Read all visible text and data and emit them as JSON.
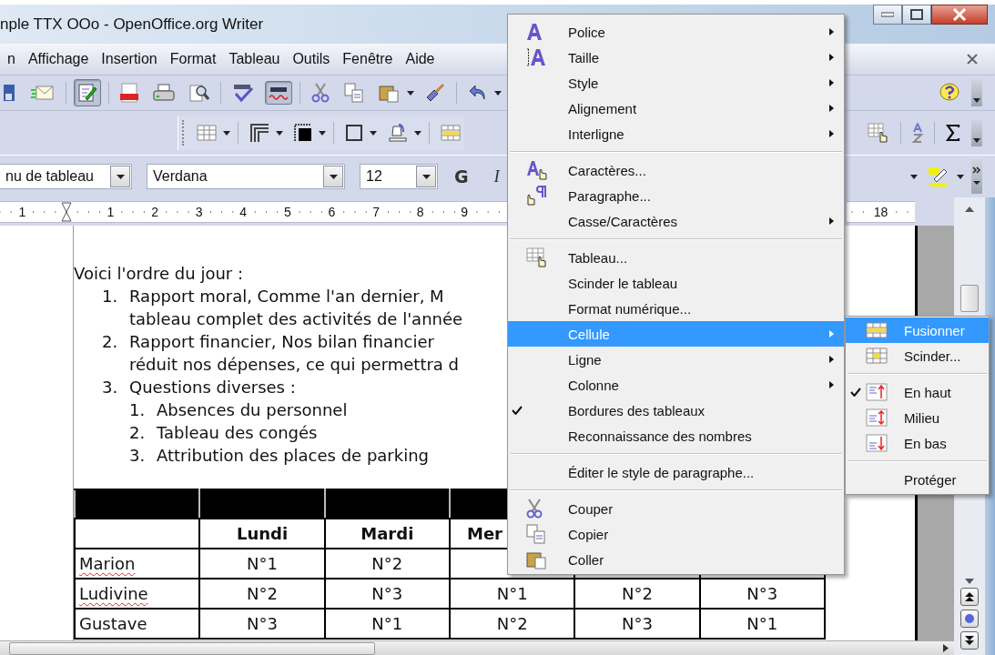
{
  "window": {
    "title": "nple TTX OOo - OpenOffice.org Writer"
  },
  "menu_bar": {
    "items": [
      {
        "label": "n"
      },
      {
        "label": "Affichage"
      },
      {
        "label": "Insertion"
      },
      {
        "label": "Format"
      },
      {
        "label": "Tableau"
      },
      {
        "label": "Outils"
      },
      {
        "label": "Fenêtre"
      },
      {
        "label": "Aide"
      }
    ]
  },
  "standard_toolbar": {
    "edit_mode_pressed": true,
    "autospell_pressed": true
  },
  "format_bar": {
    "paragraph_style": "nu de tableau",
    "font": "Verdana",
    "size": "12",
    "bold": "G",
    "italic": "I"
  },
  "ruler": {
    "labels": [
      "1",
      "1",
      "2",
      "3",
      "4",
      "5",
      "6",
      "7",
      "8",
      "9"
    ],
    "right_labels": [
      "18"
    ]
  },
  "document": {
    "intro": "Voici l'ordre du jour :",
    "list": [
      {
        "number": "1.",
        "lines": [
          "Rapport moral, Comme l'an dernier, M",
          "tableau complet des activités de l'année"
        ]
      },
      {
        "number": "2.",
        "lines": [
          "Rapport financier, Nos bilan financier",
          "réduit nos dépenses, ce qui permettra d"
        ]
      },
      {
        "number": "3.",
        "lines": [
          "Questions diverses :"
        ],
        "children": [
          {
            "number": "1.",
            "lines": [
              "Absences du personnel"
            ]
          },
          {
            "number": "2.",
            "lines": [
              "Tableau des congés"
            ]
          },
          {
            "number": "3.",
            "lines": [
              "Attribution des places de parking"
            ]
          }
        ]
      }
    ]
  },
  "table": {
    "columns": [
      {
        "label": "Lundi"
      },
      {
        "label": "Mardi"
      },
      {
        "label": "Mer"
      }
    ],
    "rows": [
      {
        "name": "Marion",
        "flagged": true,
        "cells": [
          "N°1",
          "N°2"
        ]
      },
      {
        "name": "Ludivine",
        "flagged": true,
        "cells": [
          "N°2",
          "N°3",
          "N°1",
          "N°2",
          "N°3"
        ]
      },
      {
        "name": "Gustave",
        "flagged": false,
        "cells": [
          "N°3",
          "N°1",
          "N°2",
          "N°3",
          "N°1"
        ]
      }
    ]
  },
  "context_menu": {
    "items": [
      {
        "kind": "item",
        "label": "Police",
        "submenu": true,
        "checked": false,
        "selected": false
      },
      {
        "kind": "item",
        "label": "Taille",
        "submenu": true,
        "checked": false,
        "selected": false
      },
      {
        "kind": "item",
        "label": "Style",
        "submenu": true,
        "checked": false,
        "selected": false
      },
      {
        "kind": "item",
        "label": "Alignement",
        "submenu": true,
        "checked": false,
        "selected": false
      },
      {
        "kind": "item",
        "label": "Interligne",
        "submenu": true,
        "checked": false,
        "selected": false
      },
      {
        "kind": "separator"
      },
      {
        "kind": "item",
        "label": "Caractères...",
        "submenu": false,
        "checked": false,
        "selected": false
      },
      {
        "kind": "item",
        "label": "Paragraphe...",
        "submenu": false,
        "checked": false,
        "selected": false
      },
      {
        "kind": "item",
        "label": "Casse/Caractères",
        "submenu": true,
        "checked": false,
        "selected": false
      },
      {
        "kind": "separator"
      },
      {
        "kind": "item",
        "label": "Tableau...",
        "submenu": false,
        "checked": false,
        "selected": false
      },
      {
        "kind": "item",
        "label": "Scinder le tableau",
        "submenu": false,
        "checked": false,
        "selected": false
      },
      {
        "kind": "item",
        "label": "Format numérique...",
        "submenu": false,
        "checked": false,
        "selected": false
      },
      {
        "kind": "item",
        "label": "Cellule",
        "submenu": true,
        "checked": false,
        "selected": true
      },
      {
        "kind": "item",
        "label": "Ligne",
        "submenu": true,
        "checked": false,
        "selected": false
      },
      {
        "kind": "item",
        "label": "Colonne",
        "submenu": true,
        "checked": false,
        "selected": false
      },
      {
        "kind": "item",
        "label": "Bordures des tableaux",
        "submenu": false,
        "checked": true,
        "selected": false
      },
      {
        "kind": "item",
        "label": "Reconnaissance des nombres",
        "submenu": false,
        "checked": false,
        "selected": false
      },
      {
        "kind": "separator"
      },
      {
        "kind": "item",
        "label": "Éditer le style de paragraphe...",
        "submenu": false,
        "checked": false,
        "selected": false
      },
      {
        "kind": "separator"
      },
      {
        "kind": "item",
        "label": "Couper",
        "submenu": false,
        "checked": false,
        "selected": false
      },
      {
        "kind": "item",
        "label": "Copier",
        "submenu": false,
        "checked": false,
        "selected": false
      },
      {
        "kind": "item",
        "label": "Coller",
        "submenu": false,
        "checked": false,
        "selected": false
      }
    ]
  },
  "cell_submenu": {
    "items": [
      {
        "kind": "item",
        "label": "Fusionner",
        "checked": false,
        "selected": true
      },
      {
        "kind": "item",
        "label": "Scinder...",
        "checked": false,
        "selected": false
      },
      {
        "kind": "separator"
      },
      {
        "kind": "item",
        "label": "En haut",
        "checked": true,
        "selected": false
      },
      {
        "kind": "item",
        "label": "Milieu",
        "checked": false,
        "selected": false
      },
      {
        "kind": "item",
        "label": "En bas",
        "checked": false,
        "selected": false
      },
      {
        "kind": "separator"
      },
      {
        "kind": "item",
        "label": "Protéger",
        "checked": false,
        "selected": false
      }
    ]
  }
}
